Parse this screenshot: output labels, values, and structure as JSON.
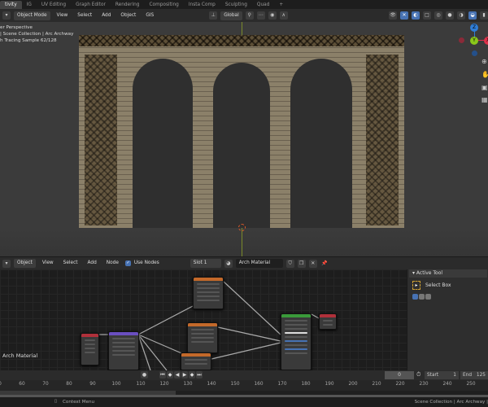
{
  "tabs": [
    "tivity",
    "IG",
    "UV Editing",
    "Graph Editor",
    "Rendering",
    "Compositing",
    "Insta Comp",
    "Sculpting",
    "Quad"
  ],
  "viewport_header": {
    "mode": "Object Mode",
    "menus": [
      "View",
      "Select",
      "Add",
      "Object",
      "GIS"
    ],
    "orientation": "Global"
  },
  "overlay": {
    "line1": "er Perspective",
    "line2": "| Scene Collection | Arc Archway",
    "line3": "h Tracing Sample 62/128"
  },
  "gizmo": {
    "z": "Z",
    "y": "Y",
    "x": "X"
  },
  "node_header": {
    "editor": "Object",
    "menus": [
      "View",
      "Select",
      "Add",
      "Node"
    ],
    "use_nodes": "Use Nodes",
    "slot": "Slot 1",
    "material": "Arch Material"
  },
  "node_tree_label": "Arch Material",
  "n_panel": {
    "section": "Active Tool",
    "tool": "Select Box"
  },
  "timeline": {
    "current_frame": "0",
    "start_label": "Start",
    "start": "1",
    "end_label": "End",
    "end": "125",
    "ticks": [
      "0",
      "60",
      "70",
      "80",
      "90",
      "100",
      "110",
      "120",
      "130",
      "140",
      "150",
      "160",
      "170",
      "180",
      "190",
      "200",
      "210",
      "220",
      "230",
      "240",
      "250"
    ]
  },
  "status": {
    "context_menu": "Context Menu",
    "right": "Scene Collection | Arc Archway |"
  }
}
